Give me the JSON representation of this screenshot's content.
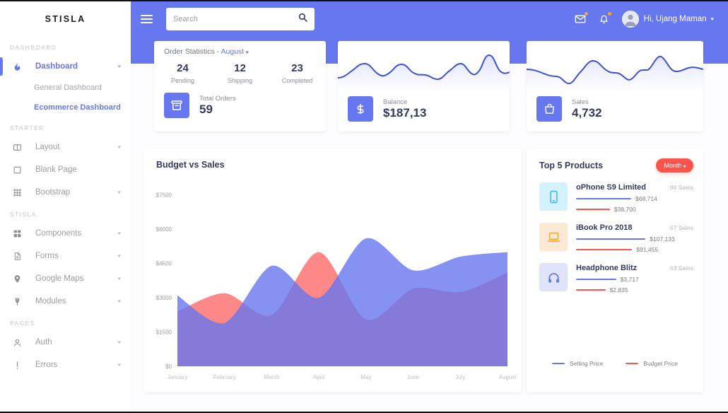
{
  "brand": "STISLA",
  "sidebar": {
    "sections": [
      {
        "header": "DASHBOARD",
        "items": [
          {
            "label": "Dashboard",
            "icon": "fire-icon",
            "caret": "▾",
            "active": true,
            "children": [
              {
                "label": "General Dashboard",
                "active": false
              },
              {
                "label": "Ecommerce Dashboard",
                "active": true
              }
            ]
          }
        ]
      },
      {
        "header": "STARTER",
        "items": [
          {
            "label": "Layout",
            "icon": "columns-icon",
            "caret": "▾"
          },
          {
            "label": "Blank Page",
            "icon": "square-icon",
            "caret": ""
          },
          {
            "label": "Bootstrap",
            "icon": "grid-icon",
            "caret": "▾"
          }
        ]
      },
      {
        "header": "STISLA",
        "items": [
          {
            "label": "Components",
            "icon": "blocks-icon",
            "caret": "▾"
          },
          {
            "label": "Forms",
            "icon": "document-icon",
            "caret": "▾"
          },
          {
            "label": "Google Maps",
            "icon": "map-pin-icon",
            "caret": "▾"
          },
          {
            "label": "Modules",
            "icon": "plug-icon",
            "caret": "▾"
          }
        ]
      },
      {
        "header": "PAGES",
        "items": [
          {
            "label": "Auth",
            "icon": "user-icon",
            "caret": "▾"
          },
          {
            "label": "Errors",
            "icon": "exclamation-icon",
            "caret": "▾"
          }
        ]
      }
    ]
  },
  "navbar": {
    "menu_icon": "hamburger-icon",
    "search": {
      "value": "",
      "placeholder": "Search",
      "icon": "search-icon"
    },
    "mail_icon": "envelope-icon",
    "bell_icon": "bell-icon",
    "user_name": "Hi, Ujang Maman",
    "user_caret": "▾",
    "bg_color": "#6777ef"
  },
  "order_card": {
    "title_prefix": "Order Statistics - ",
    "month": "August",
    "month_caret": "▾",
    "stats": [
      {
        "value": "24",
        "label": "Pending"
      },
      {
        "value": "12",
        "label": "Shipping"
      },
      {
        "value": "23",
        "label": "Completed"
      }
    ],
    "total_label": "Total Orders",
    "total_value": "59",
    "icon": "archive-box-icon"
  },
  "balance_card": {
    "label": "Balance",
    "value": "$187,13",
    "icon": "dollar-icon"
  },
  "sales_card": {
    "label": "Sales",
    "value": "4,732",
    "icon": "shopping-bag-icon"
  },
  "top_products": {
    "title": "Top 5 Products",
    "filter_label": "Month",
    "filter_caret": "▾",
    "items": [
      {
        "name": "oPhone S9 Limited",
        "sales": "86 Sales",
        "icon": "smartphone-icon",
        "icon_bg": "#d3f2fd",
        "icon_color": "#3abaf4",
        "selling": "$68,714",
        "budget": "$38,700",
        "selling_pct": 62,
        "budget_pct": 38
      },
      {
        "name": "iBook Pro 2018",
        "sales": "67 Sales",
        "icon": "laptop-icon",
        "icon_bg": "#fde9d3",
        "icon_color": "#ffa426",
        "selling": "$107,133",
        "budget": "$91,455",
        "selling_pct": 78,
        "budget_pct": 63
      },
      {
        "name": "Headphone Blitz",
        "sales": "63 Sales",
        "icon": "headphone-icon",
        "icon_bg": "#e1e3fb",
        "icon_color": "#6777ef",
        "selling": "$3,717",
        "budget": "$2,835",
        "selling_pct": 45,
        "budget_pct": 33
      }
    ],
    "legend": [
      {
        "label": "Selling Price",
        "color": "#6777ef"
      },
      {
        "label": "Budget Price",
        "color": "#fc544b"
      }
    ]
  },
  "chart_data": {
    "type": "area",
    "title": "Budget vs Sales",
    "xlabel": "",
    "ylabel": "",
    "grid": false,
    "legend_position": "bottom-right-panel",
    "categories": [
      "January",
      "February",
      "March",
      "April",
      "May",
      "June",
      "July",
      "August"
    ],
    "ytick_labels": [
      "$0",
      "$1500",
      "$3000",
      "$4500",
      "$6000",
      "$7500"
    ],
    "ytick_values": [
      0,
      1500,
      3000,
      4500,
      6000,
      7500
    ],
    "ylim": [
      0,
      7800
    ],
    "series": [
      {
        "name": "Sales",
        "color": "#6777ef",
        "values": [
          3100,
          1900,
          4400,
          3000,
          5600,
          4200,
          4800,
          5000
        ]
      },
      {
        "name": "Budget",
        "color": "#fc8282",
        "values": [
          2400,
          3200,
          2250,
          5000,
          2050,
          3400,
          3250,
          4100
        ]
      }
    ]
  }
}
